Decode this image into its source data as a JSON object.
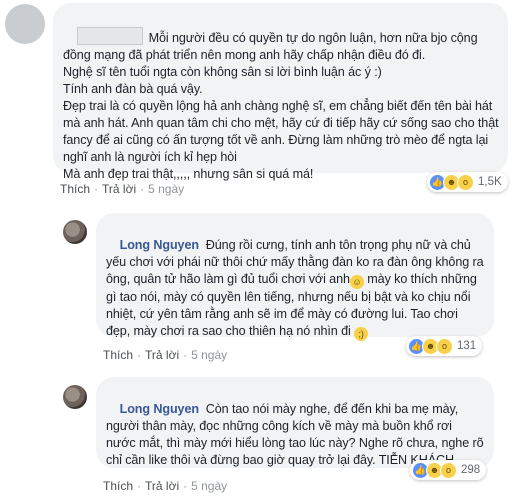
{
  "comments": [
    {
      "author": "",
      "text": "Mỗi người đều có quyền tự do ngôn luận, hơn nữa bjo cộng đồng mạng đã phát triển nên mong anh hãy chấp nhận điều đó đi.\nNghệ sĩ tên tuổi ngta còn không sân si lời bình luận ác ý :)\nTính anh đàn bà quá vậy.\nĐẹp trai là có quyền lộng hả anh chàng nghệ sĩ, em chẳng biết đến tên bài hát mà anh hát. Anh quan tâm chi cho mệt, hãy cứ đi tiếp hãy cứ sống sao cho thật fancy để ai cũng có ấn tượng tốt về anh. Đừng làm những trò mèo để ngta lại nghĩ anh là người ích kỉ hẹp hòi\nMà anh đẹp trai thật,,,,, nhưng sân si quá má!",
      "actions": {
        "like": "Thích",
        "reply": "Trả lời",
        "time": "5 ngày"
      },
      "reactions": {
        "icons": [
          "like-icon",
          "haha-icon",
          "wow-icon"
        ],
        "count": "1,5K"
      }
    },
    {
      "author": "Long Nguyen",
      "text_a": "Đúng rồi cưng, tính anh tôn trọng phụ nữ và chủ yếu chơi với phái nữ thôi chứ mấy thằng đàn ko ra đàn ông không ra ông, quân tử hão làm gì đủ tuổi chơi với anh",
      "text_b": " mày ko thích những gì tao nói, mày có quyền lên tiếng, nhưng nếu bị bật và ko chịu nổi nhiệt, cứ yên tâm rằng anh sẽ im để mày có đường lui. Tao chơi đẹp, mày chơi ra sao cho thiên hạ nó nhìn đi ",
      "actions": {
        "like": "Thích",
        "reply": "Trả lời",
        "time": "5 ngày"
      },
      "reactions": {
        "icons": [
          "like-icon",
          "haha-icon",
          "wow-icon"
        ],
        "count": "131"
      }
    },
    {
      "author": "Long Nguyen",
      "text": "Còn tao nói mày nghe, để đến khi ba mẹ mày, người thân mày, đọc những công kích về mày mà buồn khổ rơi nước mắt, thì mày mới hiểu lòng tao lúc này? Nghe rõ chưa, nghe rõ chỉ cần like thôi và đừng bao giờ quay trở lại đây. TIỄN KHÁCH.",
      "actions": {
        "like": "Thích",
        "reply": "Trả lời",
        "time": "5 ngày"
      },
      "reactions": {
        "icons": [
          "like-icon",
          "haha-icon",
          "wow-icon"
        ],
        "count": "298"
      }
    }
  ],
  "colors": {
    "name": "#385898",
    "bubble": "#f2f3f5",
    "meta": "#90949c"
  }
}
